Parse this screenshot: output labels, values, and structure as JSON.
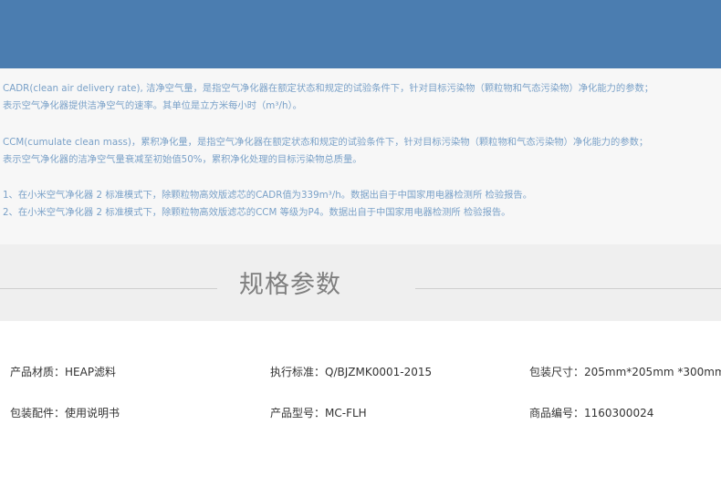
{
  "notes": {
    "cadr_line1": "CADR(clean air delivery rate), 洁净空气量，是指空气净化器在额定状态和规定的试验条件下，针对目标污染物（颗粒物和气态污染物）净化能力的参数；",
    "cadr_line2": "表示空气净化器提供洁净空气的速率。其单位是立方米每小时（m³/h）。",
    "ccm_line1": "CCM(cumulate clean mass)，累积净化量，是指空气净化器在额定状态和规定的试验条件下，针对目标污染物（颗粒物和气态污染物）净化能力的参数；",
    "ccm_line2": "表示空气净化器的洁净空气量衰减至初始值50%，累积净化处理的目标污染物总质量。",
    "footnote1": "1、在小米空气净化器 2 标准模式下，除颗粒物高效版滤芯的CADR值为339m³/h。数据出自于中国家用电器检测所 检验报告。",
    "footnote2": "2、在小米空气净化器 2 标准模式下，除颗粒物高效版滤芯的CCM 等级为P4。数据出自于中国家用电器检测所 检验报告。"
  },
  "spec_section": {
    "title": "规格参数"
  },
  "specs": {
    "material": "产品材质：HEAP滤料",
    "standard": "执行标准：Q/BJZMK0001-2015",
    "package_size": "包装尺寸：205mm*205mm *300mm",
    "accessories": "包装配件：使用说明书",
    "model": "产品型号：MC-FLH",
    "product_code": "商品编号：1160300024"
  },
  "colors": {
    "banner": "#4b7db0",
    "note_text": "#7aa1c8",
    "title_text": "#7f7f7f",
    "spec_text": "#333333"
  }
}
